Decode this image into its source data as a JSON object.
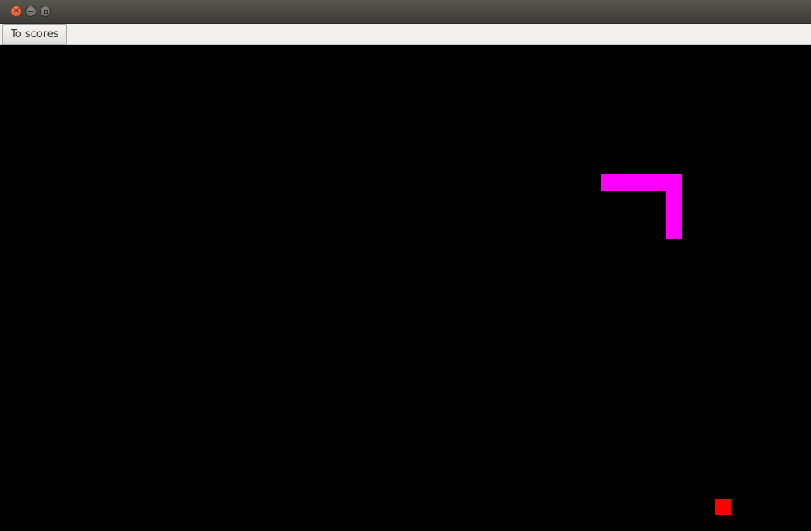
{
  "toolbar": {
    "to_scores_label": "To scores"
  },
  "titlebar": {
    "buttons": [
      "close-icon",
      "minimize-icon",
      "maximize-icon"
    ]
  },
  "colors": {
    "board": "#000000",
    "snake": "#ff00ff",
    "food": "#ff0000"
  },
  "game": {
    "grid_cell": 20,
    "snake": [
      {
        "col": 37,
        "row": 8
      },
      {
        "col": 38,
        "row": 8
      },
      {
        "col": 39,
        "row": 8
      },
      {
        "col": 40,
        "row": 8
      },
      {
        "col": 41,
        "row": 8
      },
      {
        "col": 41,
        "row": 9
      },
      {
        "col": 41,
        "row": 10
      },
      {
        "col": 41,
        "row": 11
      }
    ],
    "food": {
      "col": 44,
      "row": 28
    }
  }
}
